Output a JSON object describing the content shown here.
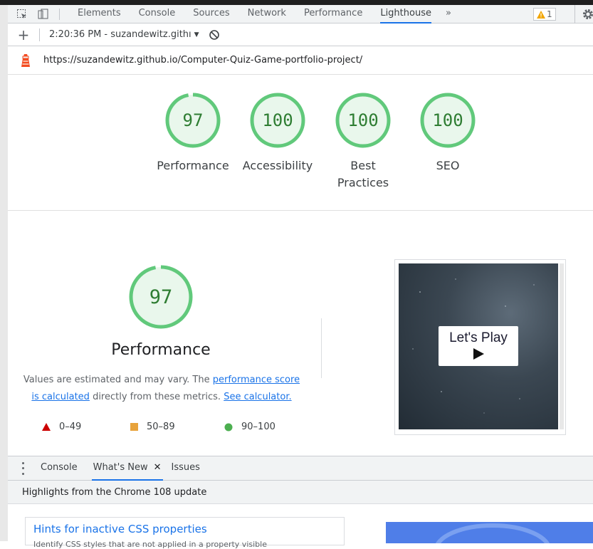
{
  "devtools": {
    "tabs": [
      "Elements",
      "Console",
      "Sources",
      "Network",
      "Performance",
      "Lighthouse"
    ],
    "active_tab": "Lighthouse",
    "more_tabs_glyph": "»",
    "warning_count": "1"
  },
  "report_bar": {
    "add_glyph": "+",
    "report_label": "2:20:36 PM - suzandewitz.githı",
    "caret": "▼"
  },
  "url": "https://suzandewitz.github.io/Computer-Quiz-Game-portfolio-project/",
  "scores": [
    {
      "value": "97",
      "label_lines": [
        "Performance"
      ]
    },
    {
      "value": "100",
      "label_lines": [
        "Accessibility"
      ]
    },
    {
      "value": "100",
      "label_lines": [
        "Best",
        "Practices"
      ]
    },
    {
      "value": "100",
      "label_lines": [
        "SEO"
      ]
    }
  ],
  "score_colors": {
    "pass": "#0cce6b",
    "pass_text": "#008800",
    "average": "#ffa400",
    "fail": "#ff4e42"
  },
  "performance": {
    "score": "97",
    "title": "Performance",
    "desc_prefix": "Values are estimated and may vary. The ",
    "desc_link1": "performance score is calculated",
    "desc_middle": " directly from these metrics. ",
    "desc_link2": "See calculator."
  },
  "legend": [
    {
      "range": "0–49",
      "shape": "triangle",
      "color": "#cc0000"
    },
    {
      "range": "50–89",
      "shape": "square",
      "color": "#e8a33b"
    },
    {
      "range": "90–100",
      "shape": "circle",
      "color": "#4caf50"
    }
  ],
  "screenshot": {
    "button_text": "Let's Play"
  },
  "drawer": {
    "tabs": [
      "Console",
      "What's New",
      "Issues"
    ],
    "active_tab": "What's New",
    "close_glyph": "✕",
    "highlights": "Highlights from the Chrome 108 update",
    "card_title": "Hints for inactive CSS properties",
    "card_desc": "Identify CSS styles that are not applied in a property visible"
  }
}
